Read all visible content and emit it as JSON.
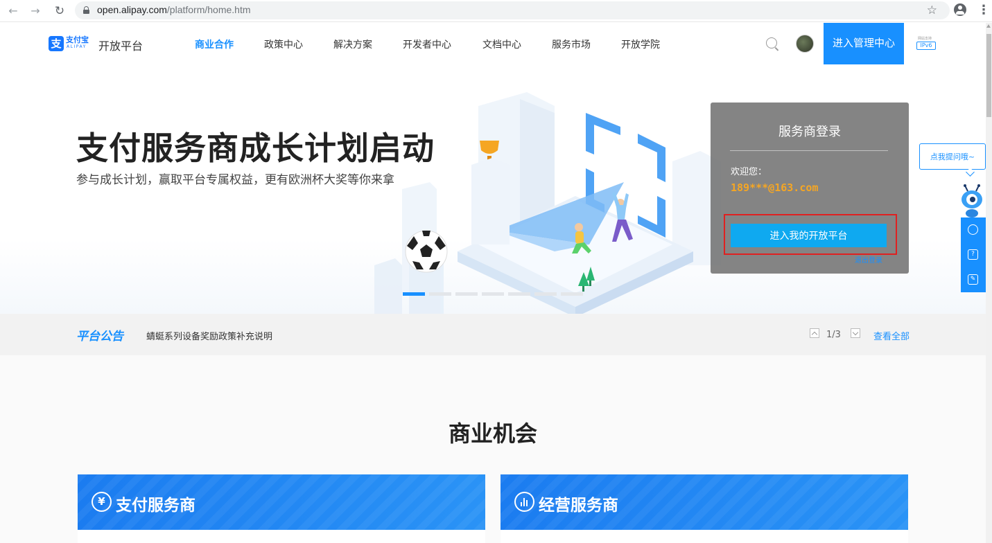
{
  "browser": {
    "url_host": "open.alipay.com",
    "url_path": "/platform/home.htm"
  },
  "header": {
    "logo_cn": "支付宝",
    "logo_en": "ALIPAY",
    "logo_mark": "支",
    "logo_sub": "开放平台",
    "nav": [
      "商业合作",
      "政策中心",
      "解决方案",
      "开发者中心",
      "文档中心",
      "服务市场",
      "开放学院"
    ],
    "active_nav": "商业合作",
    "admin_button": "进入管理中心",
    "ipv6_small": "网站支持",
    "ipv6_tag": "IPv6"
  },
  "hero": {
    "title": "支付服务商成长计划启动",
    "subtitle": "参与成长计划，赢取平台专属权益，更有欧洲杯大奖等你来拿",
    "carousel_count": 7,
    "carousel_active": 1
  },
  "login": {
    "title": "服务商登录",
    "welcome": "欢迎您：",
    "account": "189***@163.com",
    "enter_button": "进入我的开放平台",
    "logout_link": "退出登录"
  },
  "notice": {
    "tag": "平台公告",
    "text": "蜻蜓系列设备奖励政策补充说明",
    "page": "1/3",
    "view_all": "查看全部"
  },
  "business": {
    "title": "商业机会",
    "cards": [
      {
        "icon": "¥",
        "title": "支付服务商"
      },
      {
        "icon": "chart",
        "title": "经营服务商"
      }
    ]
  },
  "side": {
    "bubble": "点我提问哦~",
    "tools": [
      "headset-icon",
      "question-icon",
      "edit-icon"
    ]
  },
  "colors": {
    "brand": "#1890ff",
    "account": "#f5a623",
    "highlight": "#e02020"
  }
}
